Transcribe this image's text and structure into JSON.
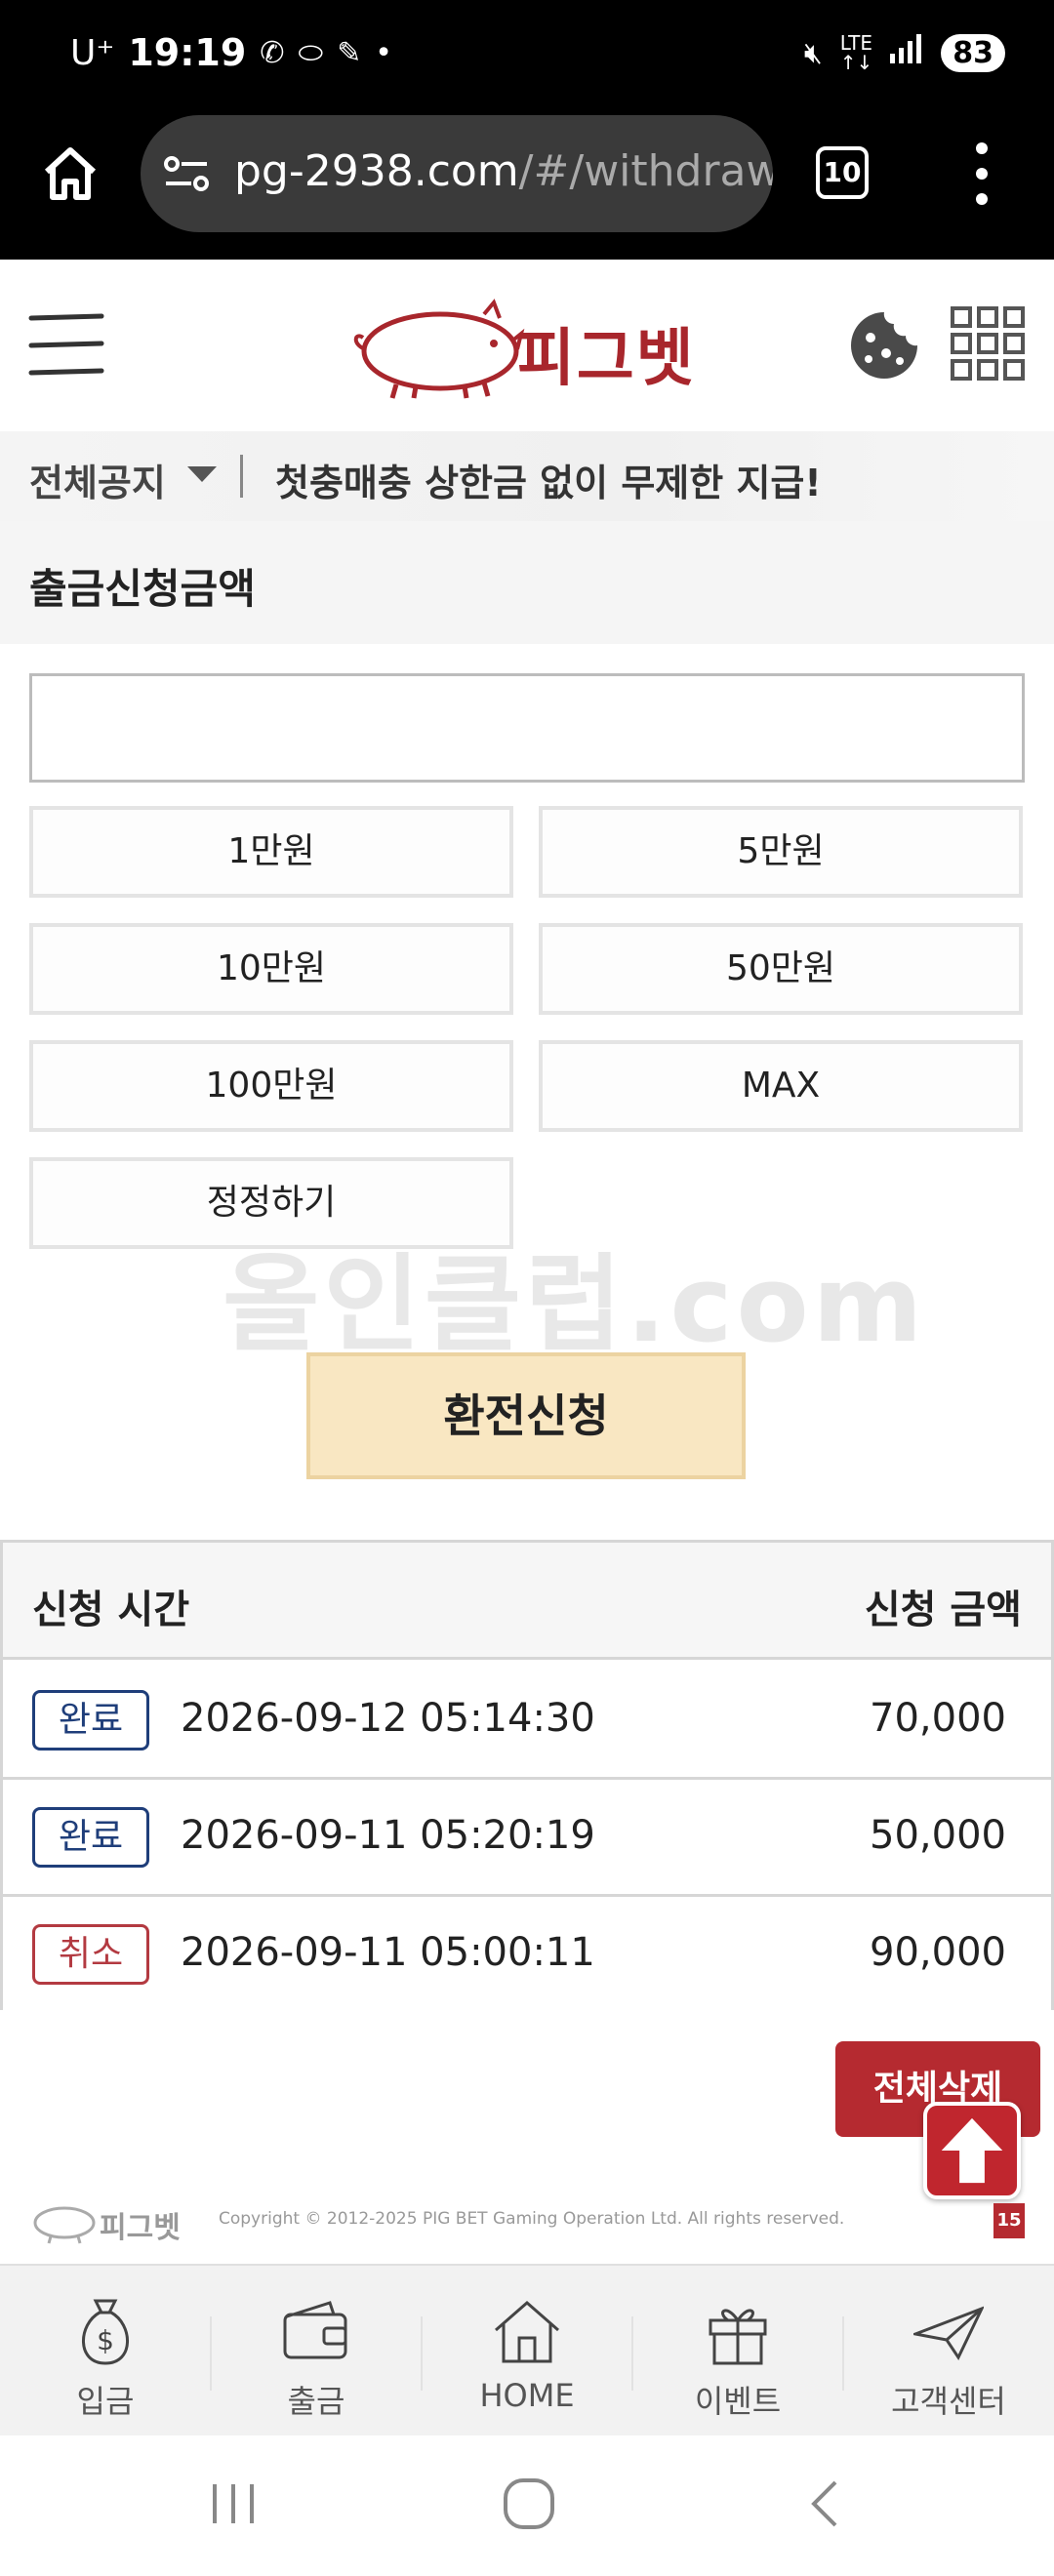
{
  "status_bar": {
    "carrier": "U⁺",
    "time": "19:19",
    "battery": "83"
  },
  "browser": {
    "url_main": "pg-2938.com",
    "url_rest": "/#/withdraw",
    "tab_count": "10"
  },
  "site": {
    "logo_text": "피그벳"
  },
  "notice": {
    "category": "전체공지",
    "text": "첫충매충 상한금 없이 무제한 지급!"
  },
  "withdraw": {
    "section_title": "출금신청금액",
    "input_value": "",
    "input_placeholder": "",
    "quick_buttons": [
      "1만원",
      "5만원",
      "10만원",
      "50만원",
      "100만원",
      "MAX",
      "정정하기"
    ],
    "submit_label": "환전신청"
  },
  "watermark": "올인클럽.com",
  "history": {
    "col_time": "신청 시간",
    "col_amount": "신청 금액",
    "rows": [
      {
        "status": "완료",
        "status_type": "done",
        "datetime": "2026-09-12 05:14:30",
        "amount": "70,000"
      },
      {
        "status": "완료",
        "status_type": "done",
        "datetime": "2026-09-11 05:20:19",
        "amount": "50,000"
      },
      {
        "status": "취소",
        "status_type": "cancel",
        "datetime": "2026-09-11 05:00:11",
        "amount": "90,000"
      }
    ],
    "delete_all_label": "전체삭제"
  },
  "footer": {
    "logo_text": "피그벳",
    "copyright": "Copyright © 2012-2025 PIG BET Gaming Operation Ltd. All rights reserved.",
    "age_badge": "15"
  },
  "bottom_nav": [
    {
      "label": "입금",
      "icon": "money-bag-icon"
    },
    {
      "label": "출금",
      "icon": "wallet-icon"
    },
    {
      "label": "HOME",
      "icon": "house-icon"
    },
    {
      "label": "이벤트",
      "icon": "gift-icon"
    },
    {
      "label": "고객센터",
      "icon": "paper-plane-icon"
    }
  ],
  "colors": {
    "brand_red": "#a8262c",
    "submit_bg": "#f9e7c2",
    "done_badge": "#1f3e7a",
    "cancel_badge": "#b33a41"
  }
}
